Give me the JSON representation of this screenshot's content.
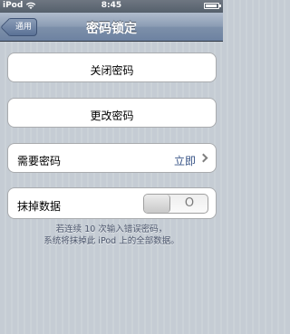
{
  "status_bar": {
    "carrier": "iPod",
    "time": "8:45",
    "wifi_icon": "wifi-icon",
    "battery_icon": "battery-icon"
  },
  "nav_bar": {
    "back_label": "通用",
    "title": "密码锁定"
  },
  "cells": {
    "turn_off": "关闭密码",
    "change": "更改密码",
    "require": {
      "label": "需要密码",
      "value": "立即"
    },
    "erase": {
      "label": "抹掉数据",
      "toggle_state": "O"
    }
  },
  "footer": {
    "line1": "若连续 10 次输入错误密码，",
    "line2": "系统将抹掉此 iPod 上的全部数据。"
  },
  "colors": {
    "accent": "#385487",
    "background": "#c5ccd4"
  }
}
